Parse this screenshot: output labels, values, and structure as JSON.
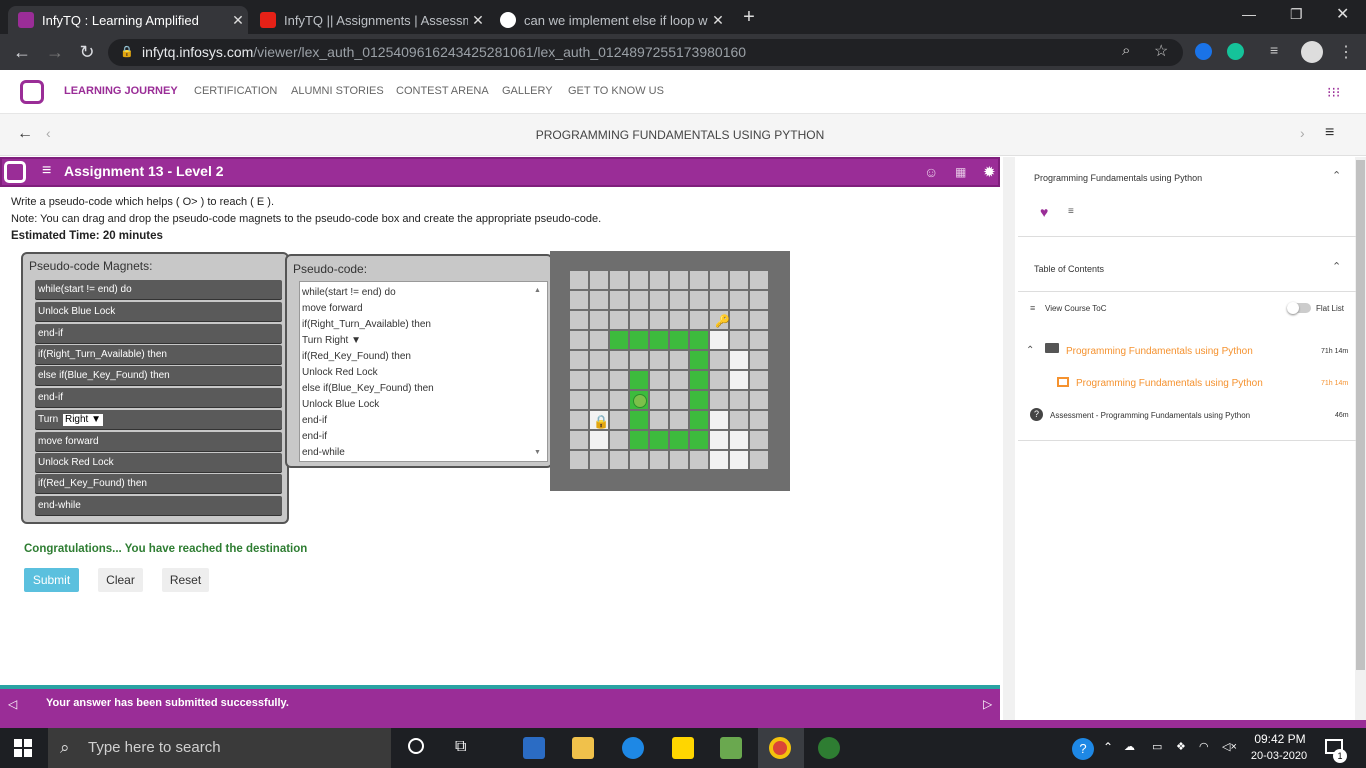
{
  "browser": {
    "tabs": [
      {
        "title": "InfyTQ : Learning Amplified",
        "active": true
      },
      {
        "title": "InfyTQ || Assignments | Assessme",
        "active": false
      },
      {
        "title": "can we implement else if loop wi",
        "active": false
      }
    ],
    "url_host": "infytq.infosys.com",
    "url_path": "/viewer/lex_auth_01254096162434252810​61/lex_auth_0124897255173980160"
  },
  "site_nav": {
    "items": [
      "LEARNING JOURNEY",
      "CERTIFICATION",
      "ALUMNI STORIES",
      "CONTEST ARENA",
      "GALLERY",
      "GET TO KNOW US"
    ]
  },
  "course_title": "PROGRAMMING FUNDAMENTALS USING PYTHON",
  "assignment": {
    "title": "Assignment 13 - Level 2",
    "instruction": "Write a pseudo-code which helps ( O> ) to reach ( E ).",
    "note": "Note: You can drag and drop the pseudo-code magnets to the pseudo-code box and create the appropriate pseudo-code.",
    "estimated_time": "Estimated Time: 20 minutes",
    "magnets_title": "Pseudo-code Magnets:",
    "magnets": [
      "while(start != end) do",
      "Unlock Blue Lock",
      "end-if",
      "if(Right_Turn_Available) then",
      "else if(Blue_Key_Found) then",
      "end-if",
      "Turn",
      "move forward",
      "Unlock Red Lock",
      "if(Red_Key_Found) then",
      "end-while"
    ],
    "turn_option": "Right",
    "pseudocode_title": "Pseudo-code:",
    "pseudocode": [
      "while(start != end) do",
      "move forward",
      "if(Right_Turn_Available) then",
      "Turn  Right",
      "if(Red_Key_Found) then",
      "Unlock Red Lock",
      "else if(Blue_Key_Found) then",
      "Unlock Blue Lock",
      "end-if",
      "end-if",
      "end-while"
    ],
    "success_message": "Congratulations... You have reached the destination",
    "buttons": {
      "submit": "Submit",
      "clear": "Clear",
      "reset": "Reset"
    },
    "status_message": "Your answer has been submitted successfully."
  },
  "sidebar": {
    "course_name": "Programming Fundamentals using Python",
    "toc_title": "Table of Contents",
    "view_toc": "View Course ToC",
    "flat_list": "Flat List",
    "items": [
      {
        "label": "Programming Fundamentals using Python",
        "duration": "71h 14m"
      },
      {
        "label": "Programming Fundamentals using Python",
        "duration": "71h 14m"
      },
      {
        "label": "Assessment - Programming Fundamentals using Python",
        "duration": "46m"
      }
    ]
  },
  "taskbar": {
    "search_placeholder": "Type here to search",
    "time": "09:42 PM",
    "date": "20-03-2020",
    "notification_count": "1"
  },
  "colors": {
    "brand_purple": "#9a2d97",
    "path_green": "#3dbb3d",
    "accent_orange": "#f5922f",
    "submit_blue": "#5bc0de"
  }
}
